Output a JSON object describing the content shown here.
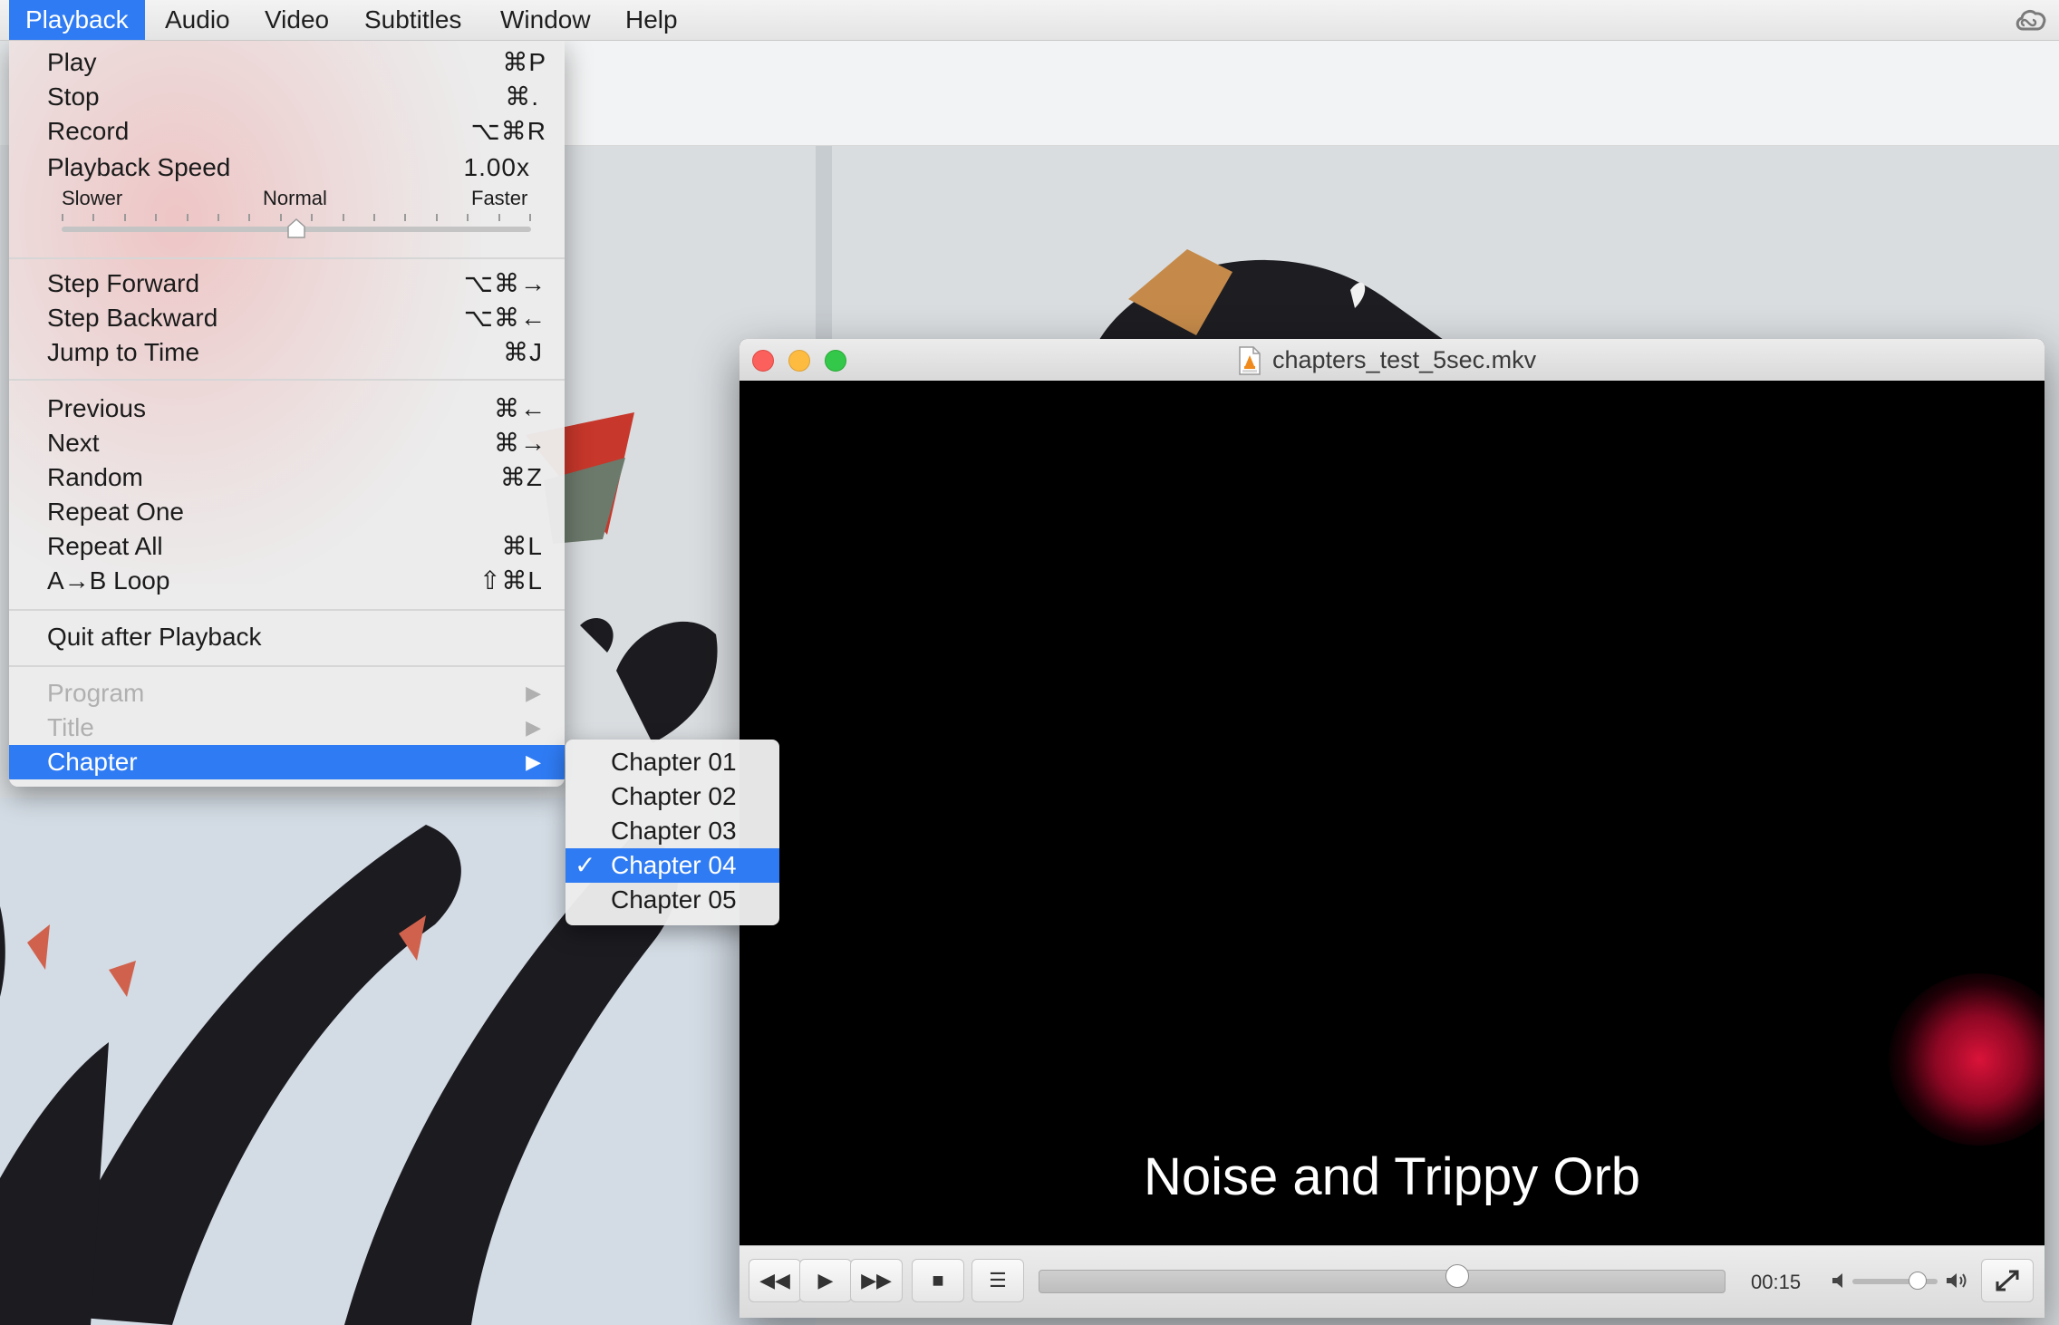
{
  "menubar": {
    "items": [
      "Playback",
      "Audio",
      "Video",
      "Subtitles",
      "Window",
      "Help"
    ],
    "active": "Playback",
    "status_icon": "creative-cloud-icon"
  },
  "playback_menu": {
    "items": [
      {
        "label": "Play",
        "shortcut": "⌘P"
      },
      {
        "label": "Stop",
        "shortcut": "⌘."
      },
      {
        "label": "Record",
        "shortcut": "⌥⌘R"
      },
      {
        "label": "Playback Speed",
        "value": "1.00x"
      },
      {
        "label": "Step Forward",
        "shortcut": "⌥⌘→"
      },
      {
        "label": "Step Backward",
        "shortcut": "⌥⌘←"
      },
      {
        "label": "Jump to Time",
        "shortcut": "⌘J"
      },
      {
        "label": "Previous",
        "shortcut": "⌘←"
      },
      {
        "label": "Next",
        "shortcut": "⌘→"
      },
      {
        "label": "Random",
        "shortcut": "⌘Z"
      },
      {
        "label": "Repeat One",
        "shortcut": ""
      },
      {
        "label": "Repeat All",
        "shortcut": "⌘L"
      },
      {
        "label": "A→B Loop",
        "shortcut": "⇧⌘L"
      },
      {
        "label": "Quit after Playback",
        "shortcut": ""
      },
      {
        "label": "Program",
        "disabled": true
      },
      {
        "label": "Title",
        "disabled": true
      },
      {
        "label": "Chapter",
        "highlighted": true
      }
    ],
    "speed_slider": {
      "slower": "Slower",
      "normal": "Normal",
      "faster": "Faster",
      "position": 0.5
    }
  },
  "chapter_menu": {
    "items": [
      "Chapter 01",
      "Chapter 02",
      "Chapter 03",
      "Chapter 04",
      "Chapter 05"
    ],
    "selected_index": 3,
    "check": "✓"
  },
  "window": {
    "title": "chapters_test_5sec.mkv",
    "subtitle": "Noise and Trippy Orb",
    "time": "00:15",
    "seek_fraction": 0.61,
    "volume_fraction": 0.75,
    "colors": {
      "close": "#fc605c",
      "minimize": "#fdbc40",
      "zoom": "#34c84a",
      "accent": "#2f7bf3"
    }
  }
}
